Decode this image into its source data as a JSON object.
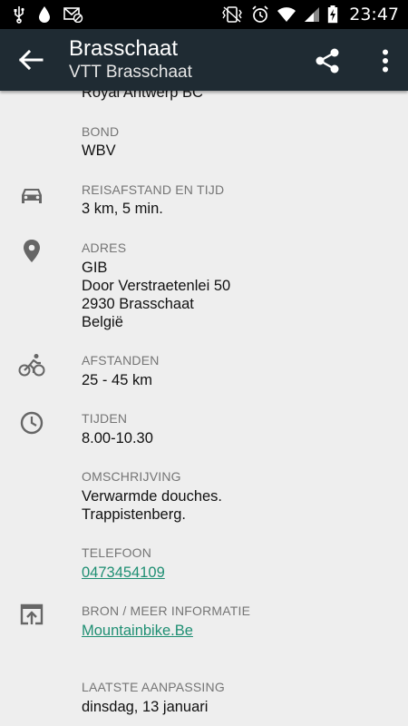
{
  "status_bar": {
    "time": "23:47"
  },
  "app_bar": {
    "title": "Brasschaat",
    "subtitle": "VTT Brasschaat"
  },
  "sections": {
    "club": {
      "value": "Royal Antwerp BC"
    },
    "bond": {
      "label": "BOND",
      "value": "WBV"
    },
    "reisafstand": {
      "label": "REISAFSTAND EN TIJD",
      "value": "3 km, 5 min.",
      "icon": "car-icon"
    },
    "adres": {
      "label": "ADRES",
      "lines": [
        "GIB",
        "Door Verstraetenlei 50",
        "2930  Brasschaat",
        "België"
      ],
      "icon": "location-pin-icon"
    },
    "afstanden": {
      "label": "AFSTANDEN",
      "value": "25 - 45 km",
      "icon": "bicycle-icon"
    },
    "tijden": {
      "label": "TIJDEN",
      "value": "8.00-10.30",
      "icon": "clock-icon"
    },
    "omschrijving": {
      "label": "OMSCHRIJVING",
      "lines": [
        "Verwarmde douches.",
        "Trappistenberg."
      ]
    },
    "telefoon": {
      "label": "TELEFOON",
      "value": "0473454109"
    },
    "bron": {
      "label": "BRON / MEER INFORMATIE",
      "value": "Mountainbike.Be",
      "icon": "open-in-browser-icon"
    },
    "laatste": {
      "label": "LAATSTE AANPASSING",
      "value": "dinsdag, 13 januari"
    }
  },
  "colors": {
    "app_bar": "#1f2b33",
    "link": "#1f8f73",
    "background": "#eeeeee",
    "label": "#757575"
  }
}
